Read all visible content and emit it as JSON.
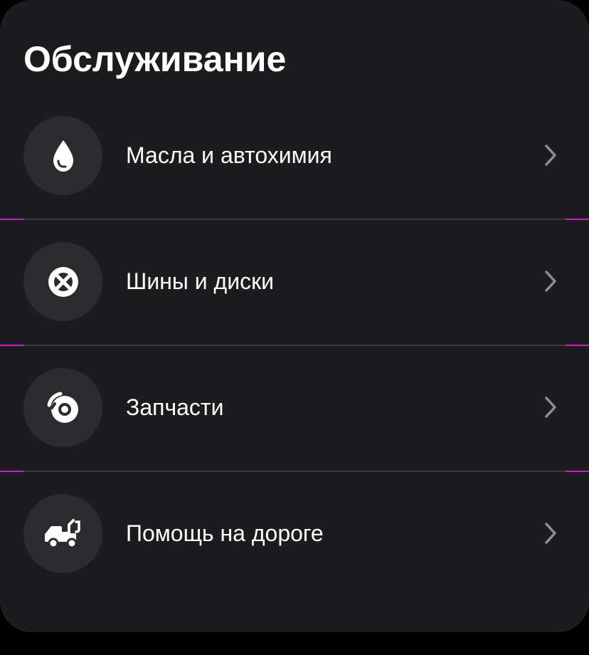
{
  "header": {
    "title": "Обслуживание"
  },
  "menu": {
    "items": [
      {
        "label": "Масла и автохимия",
        "icon": "oil-drop-icon"
      },
      {
        "label": "Шины и диски",
        "icon": "wheel-icon"
      },
      {
        "label": "Запчасти",
        "icon": "brake-disc-icon"
      },
      {
        "label": "Помощь на дороге",
        "icon": "tow-truck-icon"
      }
    ]
  },
  "colors": {
    "card_background": "#1c1c1e",
    "icon_circle": "#2c2c2e",
    "divider": "#3a3a3c",
    "divider_accent": "#c81ec8",
    "chevron": "#8e8e93",
    "text": "#ffffff"
  }
}
